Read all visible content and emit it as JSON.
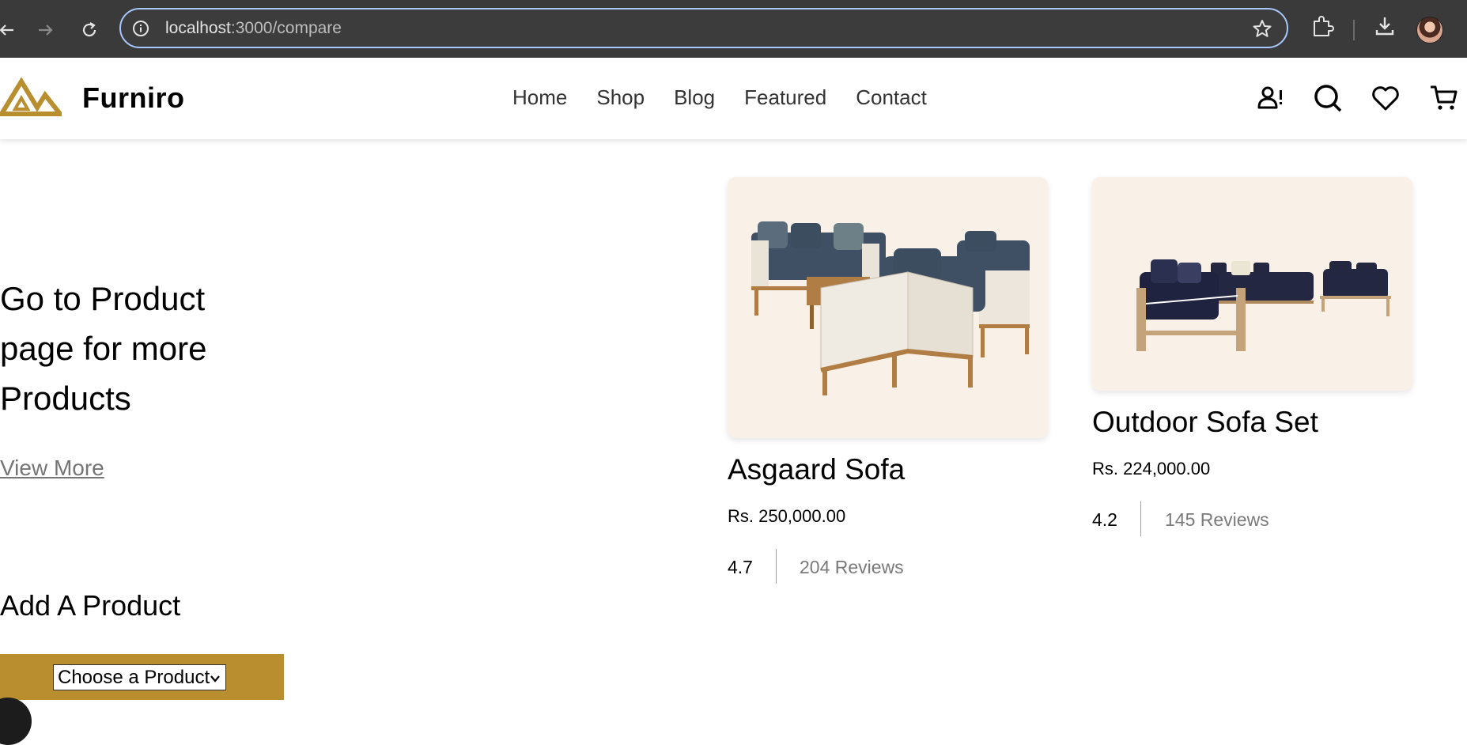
{
  "browser": {
    "url_host": "localhost",
    "url_path": ":3000/compare"
  },
  "site": {
    "brand": "Furniro",
    "brand_color": "#b88e2f",
    "nav": [
      "Home",
      "Shop",
      "Blog",
      "Featured",
      "Contact"
    ]
  },
  "promo": {
    "title": "Go to Product page for more Products",
    "link": "View More"
  },
  "add_product": {
    "title": "Add A Product",
    "select_value": "Choose a Product"
  },
  "products": [
    {
      "name": "Asgaard Sofa",
      "price": "Rs. 250,000.00",
      "rating": "4.7",
      "reviews": "204 Reviews"
    },
    {
      "name": "Outdoor Sofa Set",
      "price": "Rs. 224,000.00",
      "rating": "4.2",
      "reviews": "145 Reviews"
    }
  ]
}
